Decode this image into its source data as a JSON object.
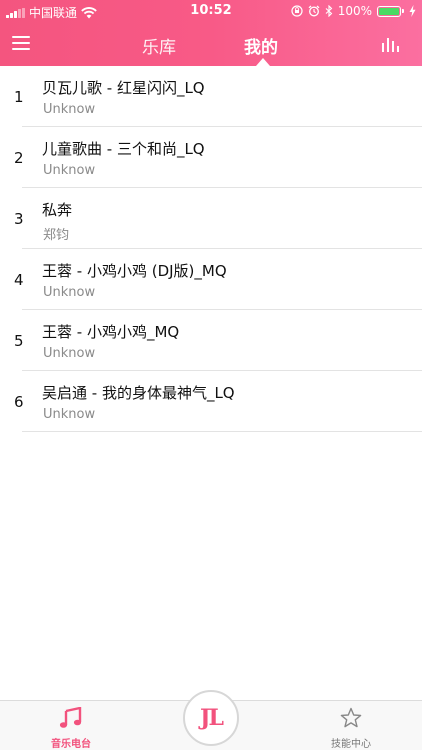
{
  "status_bar": {
    "carrier": "中国联通",
    "time": "10:52",
    "battery": "100%"
  },
  "header": {
    "tabs": [
      {
        "label": "乐库",
        "active": false
      },
      {
        "label": "我的",
        "active": true
      }
    ]
  },
  "songs": [
    {
      "index": "1",
      "title": "贝瓦儿歌 - 红星闪闪_LQ",
      "artist": "Unknow"
    },
    {
      "index": "2",
      "title": "儿童歌曲 - 三个和尚_LQ",
      "artist": "Unknow"
    },
    {
      "index": "3",
      "title": "私奔",
      "artist": "郑钧"
    },
    {
      "index": "4",
      "title": "王蓉 - 小鸡小鸡 (DJ版)_MQ",
      "artist": "Unknow"
    },
    {
      "index": "5",
      "title": "王蓉 - 小鸡小鸡_MQ",
      "artist": "Unknow"
    },
    {
      "index": "6",
      "title": "吴启通 - 我的身体最神气_LQ",
      "artist": "Unknow"
    }
  ],
  "bottom_nav": {
    "radio": {
      "label": "音乐电台",
      "icon": "music-note-icon"
    },
    "center": {
      "label": "JL",
      "icon": "logo-icon"
    },
    "skill": {
      "label": "技能中心",
      "icon": "star-icon"
    }
  },
  "colors": {
    "accent": "#f2527d",
    "header_start": "#f4557f",
    "header_end": "#fb6fa0"
  }
}
